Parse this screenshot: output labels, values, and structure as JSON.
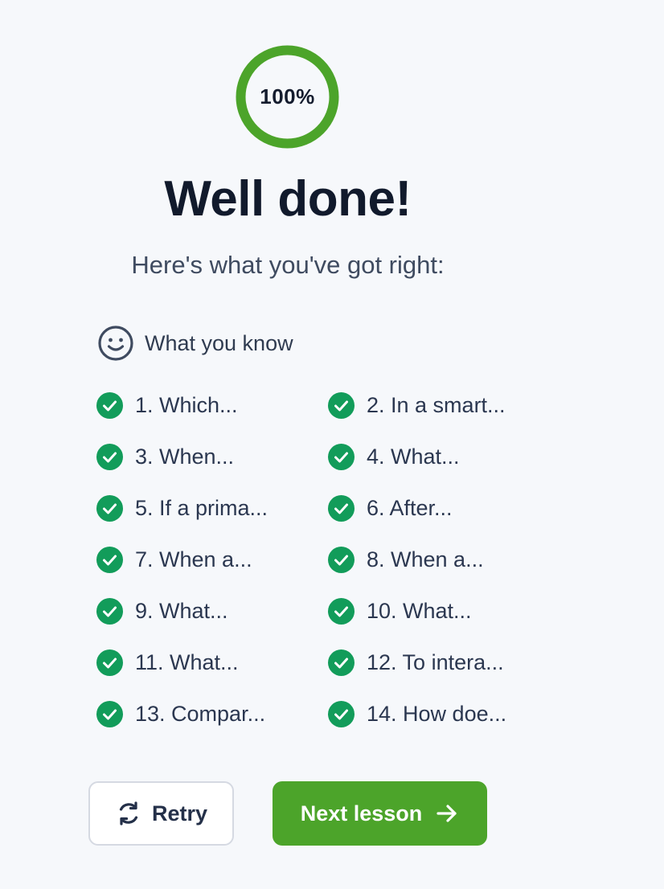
{
  "score": {
    "label": "100%",
    "progress": 1.0,
    "ring_color": "#4ca42a"
  },
  "title": "Well done!",
  "subtitle": "Here's what you've got right:",
  "section": {
    "icon": "smile-icon",
    "label": "What you know"
  },
  "items": [
    {
      "label": "1. Which...",
      "status": "correct"
    },
    {
      "label": "2. In a smart...",
      "status": "correct"
    },
    {
      "label": "3. When...",
      "status": "correct"
    },
    {
      "label": "4. What...",
      "status": "correct"
    },
    {
      "label": "5. If a prima...",
      "status": "correct"
    },
    {
      "label": "6. After...",
      "status": "correct"
    },
    {
      "label": "7. When a...",
      "status": "correct"
    },
    {
      "label": "8. When a...",
      "status": "correct"
    },
    {
      "label": "9. What...",
      "status": "correct"
    },
    {
      "label": "10. What...",
      "status": "correct"
    },
    {
      "label": "11. What...",
      "status": "correct"
    },
    {
      "label": "12. To intera...",
      "status": "correct"
    },
    {
      "label": "13. Compar...",
      "status": "correct"
    },
    {
      "label": "14. How doe...",
      "status": "correct"
    }
  ],
  "check_color": "#129c5a",
  "buttons": {
    "retry": {
      "label": "Retry",
      "icon": "refresh-icon"
    },
    "next": {
      "label": "Next lesson",
      "icon": "arrow-right-icon",
      "color": "#4ca42a"
    }
  }
}
